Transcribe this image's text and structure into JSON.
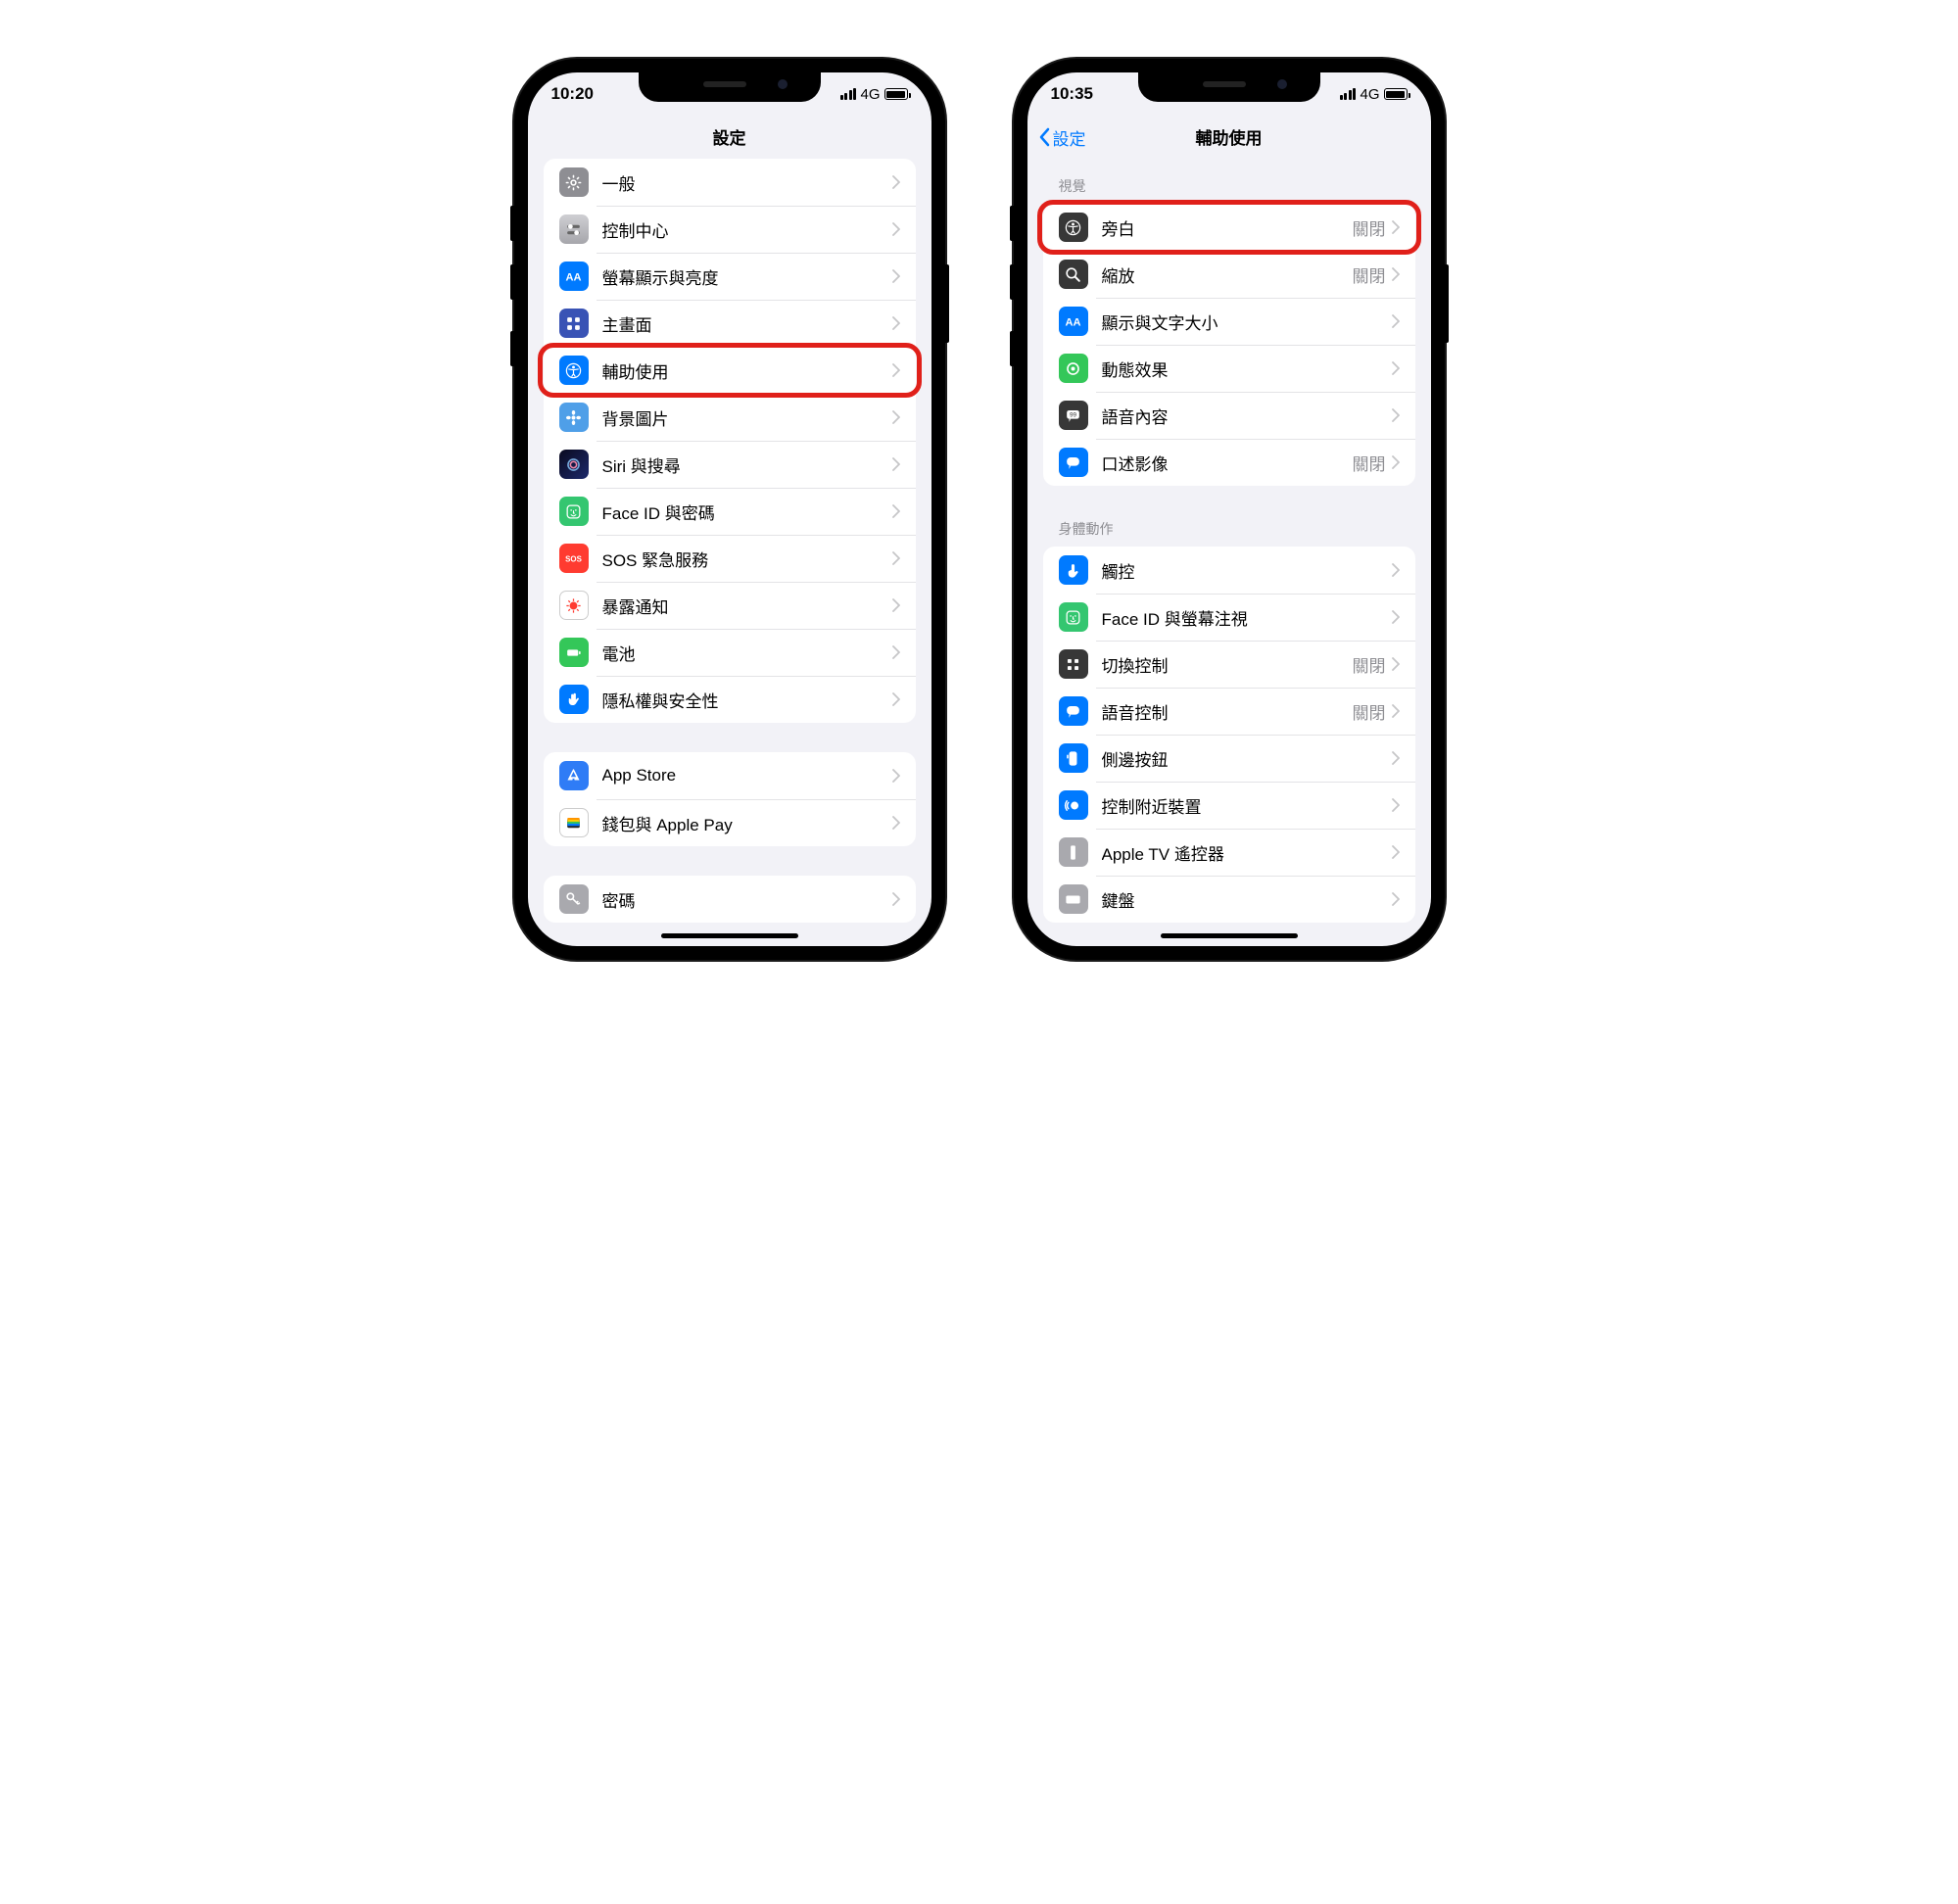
{
  "left": {
    "status": {
      "time": "10:20",
      "net": "4G"
    },
    "nav": {
      "title": "設定"
    },
    "group1": [
      {
        "id": "general",
        "label": "一般",
        "icon": "gear",
        "color": "c-gray"
      },
      {
        "id": "control-center",
        "label": "控制中心",
        "icon": "switches",
        "color": "c-graydot"
      },
      {
        "id": "display",
        "label": "螢幕顯示與亮度",
        "icon": "aa",
        "color": "c-blue"
      },
      {
        "id": "home-screen",
        "label": "主畫面",
        "icon": "apps",
        "color": "c-bluegrid"
      },
      {
        "id": "accessibility",
        "label": "輔助使用",
        "icon": "access",
        "color": "c-blue",
        "highlight": true
      },
      {
        "id": "wallpaper",
        "label": "背景圖片",
        "icon": "flower",
        "color": "c-cyan"
      },
      {
        "id": "siri",
        "label": "Siri 與搜尋",
        "icon": "siri",
        "color": "c-siri"
      },
      {
        "id": "faceid",
        "label": "Face ID 與密碼",
        "icon": "faceid",
        "color": "c-green2"
      },
      {
        "id": "sos",
        "label": "SOS 緊急服務",
        "icon": "sos",
        "color": "c-red"
      },
      {
        "id": "exposure",
        "label": "暴露通知",
        "icon": "virus",
        "color": "c-white"
      },
      {
        "id": "battery",
        "label": "電池",
        "icon": "battery",
        "color": "c-green"
      },
      {
        "id": "privacy",
        "label": "隱私權與安全性",
        "icon": "hand",
        "color": "c-blue"
      }
    ],
    "group2": [
      {
        "id": "appstore",
        "label": "App Store",
        "icon": "appstore",
        "color": "c-blue2"
      },
      {
        "id": "wallet",
        "label": "錢包與 Apple Pay",
        "icon": "wallet",
        "color": "c-white"
      }
    ],
    "group3": [
      {
        "id": "passwords",
        "label": "密碼",
        "icon": "key",
        "color": "c-lightgray"
      }
    ]
  },
  "right": {
    "status": {
      "time": "10:35",
      "net": "4G"
    },
    "nav": {
      "back": "設定",
      "title": "輔助使用"
    },
    "sec1_header": "視覺",
    "sec1": [
      {
        "id": "voiceover",
        "label": "旁白",
        "value": "關閉",
        "icon": "access",
        "color": "c-darkgray",
        "highlight": true
      },
      {
        "id": "zoom",
        "label": "縮放",
        "value": "關閉",
        "icon": "zoom",
        "color": "c-darkgray"
      },
      {
        "id": "display-text",
        "label": "顯示與文字大小",
        "value": "",
        "icon": "aa",
        "color": "c-blue"
      },
      {
        "id": "motion",
        "label": "動態效果",
        "value": "",
        "icon": "motion",
        "color": "c-green"
      },
      {
        "id": "spoken",
        "label": "語音內容",
        "value": "",
        "icon": "speech",
        "color": "c-darkgray"
      },
      {
        "id": "audio-desc",
        "label": "口述影像",
        "value": "關閉",
        "icon": "bubble",
        "color": "c-blue"
      }
    ],
    "sec2_header": "身體動作",
    "sec2": [
      {
        "id": "touch",
        "label": "觸控",
        "value": "",
        "icon": "touch",
        "color": "c-blue"
      },
      {
        "id": "faceid-attn",
        "label": "Face ID 與螢幕注視",
        "value": "",
        "icon": "faceid",
        "color": "c-green2"
      },
      {
        "id": "switch-control",
        "label": "切換控制",
        "value": "關閉",
        "icon": "switch",
        "color": "c-darkgray"
      },
      {
        "id": "voice-control",
        "label": "語音控制",
        "value": "關閉",
        "icon": "voice",
        "color": "c-blue"
      },
      {
        "id": "side-button",
        "label": "側邊按鈕",
        "value": "",
        "icon": "side",
        "color": "c-blue"
      },
      {
        "id": "nearby",
        "label": "控制附近裝置",
        "value": "",
        "icon": "nearby",
        "color": "c-blue"
      },
      {
        "id": "appletv",
        "label": "Apple TV 遙控器",
        "value": "",
        "icon": "remote",
        "color": "c-lightgray"
      },
      {
        "id": "keyboard",
        "label": "鍵盤",
        "value": "",
        "icon": "keyboard",
        "color": "c-lightgray"
      }
    ]
  }
}
